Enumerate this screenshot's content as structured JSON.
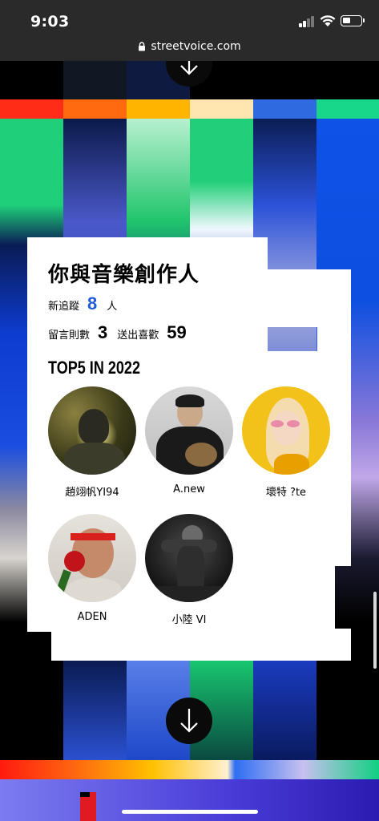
{
  "status_bar": {
    "time": "9:03",
    "battery_level": 0.45
  },
  "browser": {
    "url": "streetvoice.com"
  },
  "card": {
    "title": "你與音樂創作人",
    "new_follows_label": "新追蹤",
    "new_follows_value": "8",
    "new_follows_unit": "人",
    "comments_label": "留言則數",
    "comments_value": "3",
    "likes_label": "送出喜歡",
    "likes_value": "59",
    "top5_title": "TOP5 IN 2022",
    "accent_color": "#1f5bd6"
  },
  "artists": [
    {
      "name": "趙翊帆YI94",
      "icon": "avatar-photo"
    },
    {
      "name": "A.new",
      "icon": "avatar-photo"
    },
    {
      "name": "壞特 ?te",
      "icon": "avatar-photo"
    },
    {
      "name": "ADEN",
      "icon": "avatar-photo"
    },
    {
      "name": "小陸 VI",
      "icon": "avatar-photo"
    }
  ]
}
